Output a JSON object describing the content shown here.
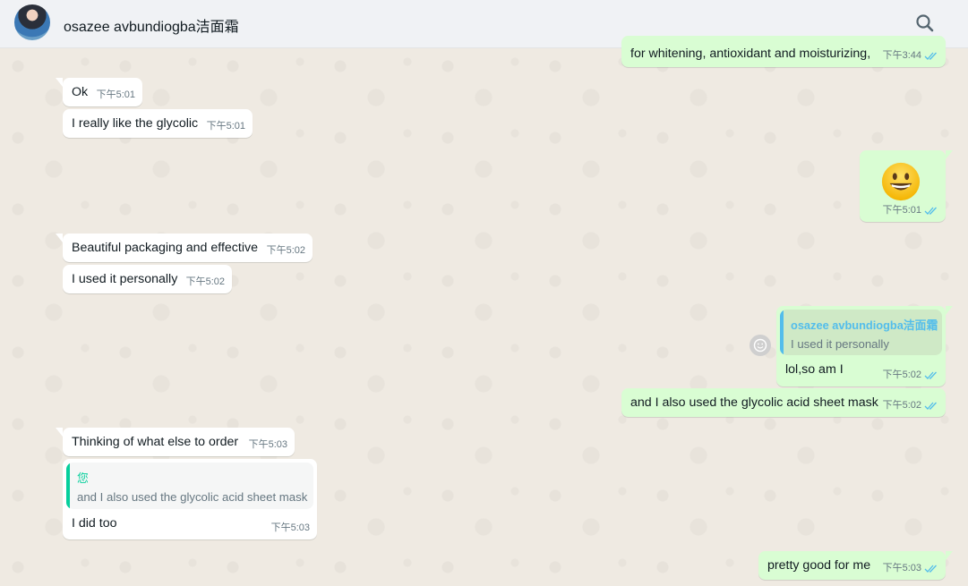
{
  "header": {
    "contact_name": "osazee avbundiogba洁面霜",
    "search_icon": "search-icon"
  },
  "colors": {
    "incoming_bubble": "#ffffff",
    "outgoing_bubble": "#d9fdd3",
    "read_ticks": "#53bdeb",
    "quote_self": "#06cf9c",
    "quote_contact": "#53bdeb"
  },
  "messages": {
    "m0": {
      "text": "for whitening, antioxidant and moisturizing,",
      "time": "下午3:44"
    },
    "m1": {
      "text": "Ok",
      "time": "下午5:01"
    },
    "m2": {
      "text": "I really like the glycolic",
      "time": "下午5:01"
    },
    "m3": {
      "emoji": "grinning-face",
      "time": "下午5:01"
    },
    "m4": {
      "text": "Beautiful packaging and effective",
      "time": "下午5:02"
    },
    "m5": {
      "text": "I used it personally",
      "time": "下午5:02"
    },
    "m6": {
      "quote_name": "osazee avbundiogba洁面霜",
      "quote_text": "I used it personally",
      "text": "lol,so am I",
      "time": "下午5:02"
    },
    "m7": {
      "text": "and I also used the glycolic acid sheet mask",
      "time": "下午5:02"
    },
    "m8": {
      "text": "Thinking of what else to order",
      "time": "下午5:03"
    },
    "m9": {
      "quote_name": "您",
      "quote_text": "and I also used the glycolic acid sheet mask",
      "text": "I did too",
      "time": "下午5:03"
    },
    "m10": {
      "text": "pretty good for me",
      "time": "下午5:03"
    }
  }
}
